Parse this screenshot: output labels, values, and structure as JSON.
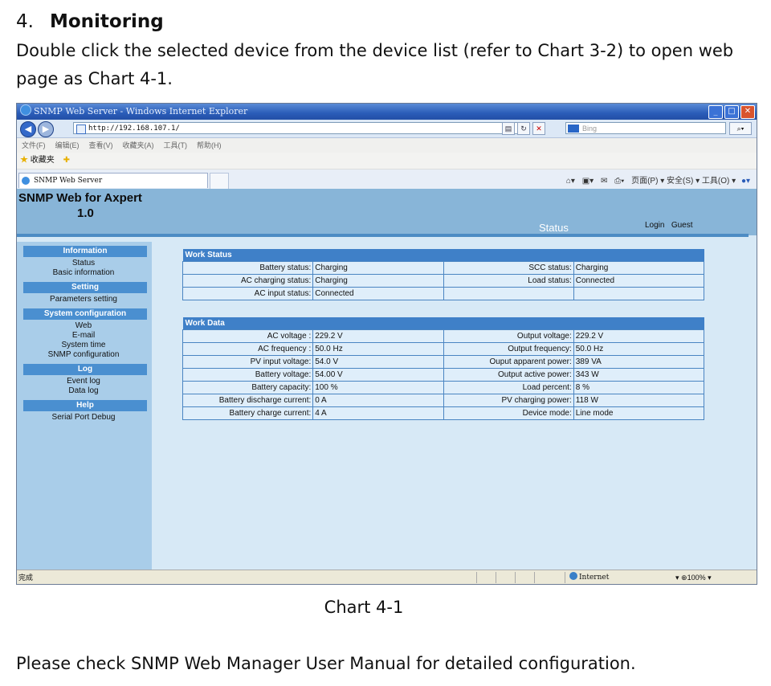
{
  "doc": {
    "heading_num": "4.",
    "heading_text": "Monitoring",
    "para": "Double click the selected device from the device list (refer to Chart 3-2) to open web page as Chart 4-1.",
    "caption": "Chart 4-1",
    "footer": "Please check SNMP Web Manager User Manual for detailed configuration."
  },
  "browser": {
    "title": "SNMP Web Server - Windows Internet Explorer",
    "url": "http://192.168.107.1/",
    "search_placeholder": "Bing",
    "menu": [
      "文件(F)",
      "编辑(E)",
      "查看(V)",
      "收藏夹(A)",
      "工具(T)",
      "帮助(H)"
    ],
    "favorites": "收藏夹",
    "tab_title": "SNMP Web Server",
    "command_bar": "页面(P) ▾  安全(S) ▾  工具(O) ▾",
    "status_done": "完成",
    "zone": "Internet",
    "zoom": "100%",
    "icons": [
      "ie-icon",
      "back-icon",
      "forward-icon",
      "refresh-icon",
      "stop-icon",
      "search-icon",
      "home-icon",
      "print-icon",
      "help-icon",
      "star-icon"
    ]
  },
  "page": {
    "brand_line1": "SNMP Web for Axpert",
    "brand_line2": "1.0",
    "status_tab": "Status",
    "login_label": "Login",
    "login_user": "Guest",
    "sidebar": [
      {
        "head": "Information",
        "items": [
          "Status",
          "Basic information"
        ]
      },
      {
        "head": "Setting",
        "items": [
          "Parameters setting"
        ]
      },
      {
        "head": "System configuration",
        "items": [
          "Web",
          "E-mail",
          "System time",
          "SNMP configuration"
        ]
      },
      {
        "head": "Log",
        "items": [
          "Event log",
          "Data log"
        ]
      },
      {
        "head": "Help",
        "items": [
          "Serial Port Debug"
        ]
      }
    ],
    "work_status": {
      "title": "Work Status",
      "rows": [
        [
          "Battery status:",
          "Charging",
          "SCC status:",
          "Charging"
        ],
        [
          "AC charging status:",
          "Charging",
          "Load status:",
          "Connected"
        ],
        [
          "AC input status:",
          "Connected",
          "",
          ""
        ]
      ]
    },
    "work_data": {
      "title": "Work Data",
      "rows": [
        [
          "AC voltage :",
          "229.2 V",
          "Output voltage:",
          "229.2 V"
        ],
        [
          "AC frequency :",
          "50.0 Hz",
          "Output frequency:",
          "50.0 Hz"
        ],
        [
          "PV input voltage:",
          "54.0 V",
          "Ouput apparent power:",
          "389 VA"
        ],
        [
          "Battery voltage:",
          "54.00 V",
          "Output active power:",
          "343 W"
        ],
        [
          "Battery capacity:",
          "100  %",
          "Load percent:",
          "8    %"
        ],
        [
          "Battery discharge current:",
          "0    A",
          "PV charging power:",
          "118    W"
        ],
        [
          "Battery charge current:",
          "4    A",
          "Device mode:",
          "Line mode"
        ]
      ]
    }
  }
}
